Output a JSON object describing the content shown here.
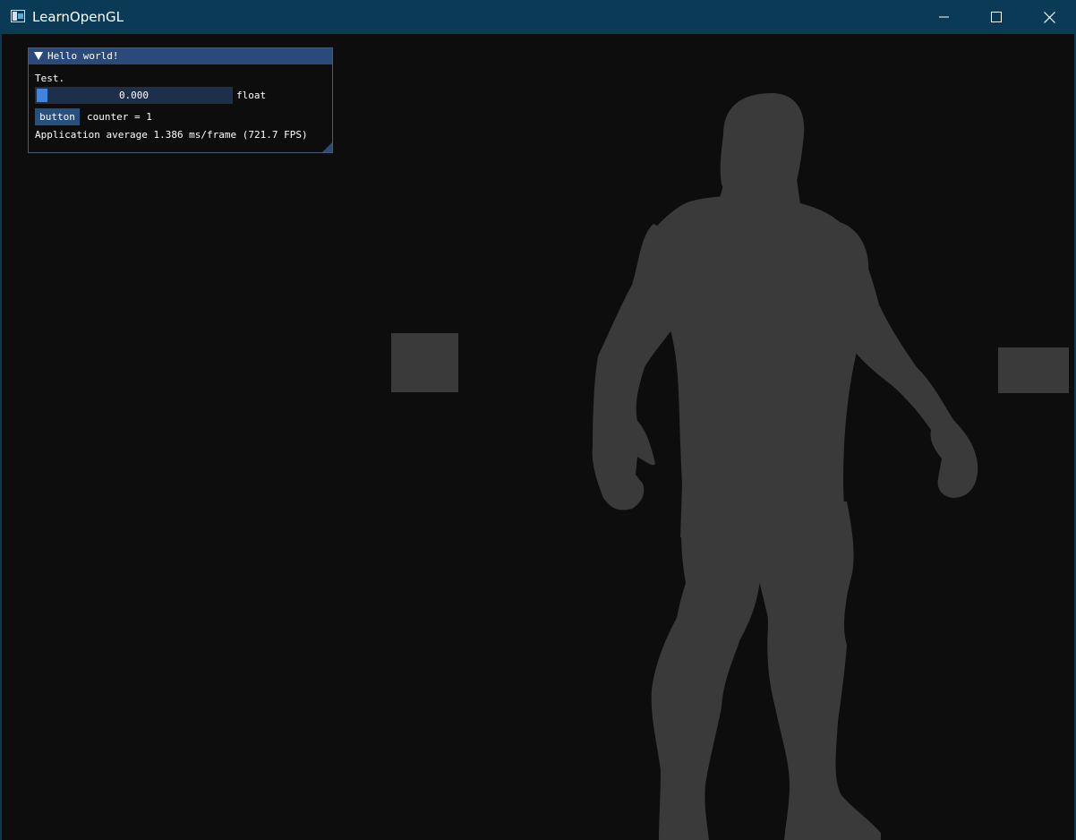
{
  "window": {
    "title": "LearnOpenGL",
    "icons": {
      "app": "app-window-icon",
      "minimize": "minimize-icon",
      "maximize": "maximize-icon",
      "close": "close-icon"
    },
    "colors": {
      "titlebar": "#0b3a56",
      "viewport": "#0d0d0d"
    }
  },
  "scene": {
    "objects": [
      "depth-cube-left",
      "depth-cube-right",
      "character-silhouette"
    ],
    "colors": {
      "object_gray": "#3a3a3a"
    }
  },
  "imgui": {
    "title": "Hello world!",
    "text": "Test.",
    "slider": {
      "value_text": "0.000",
      "value": 0.0,
      "label": "float"
    },
    "button_label": "button",
    "counter_text": "counter = 1",
    "fps_text": "Application average 1.386 ms/frame (721.7 FPS)",
    "colors": {
      "titlebar": "#294a7a",
      "slider_bg": "#1d2f4b",
      "slider_grab": "#3d85e0",
      "button": "#26507f"
    }
  }
}
